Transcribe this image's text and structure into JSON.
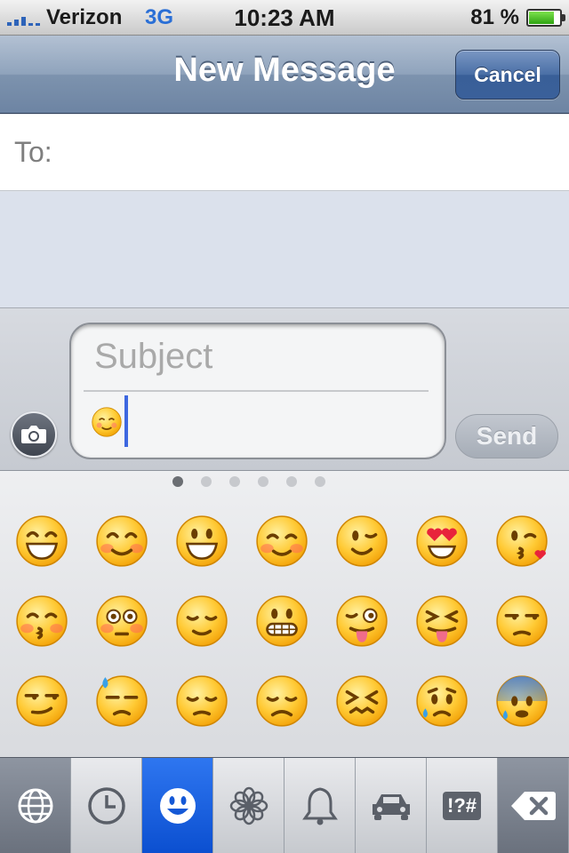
{
  "status_bar": {
    "carrier": "Verizon",
    "network": "3G",
    "time": "10:23 AM",
    "battery_percent": "81 %",
    "battery_level": 0.81
  },
  "nav_bar": {
    "title": "New Message",
    "cancel_label": "Cancel"
  },
  "recipient": {
    "label": "To:",
    "value": ""
  },
  "compose": {
    "subject_placeholder": "Subject",
    "body_value": "☺️",
    "send_label": "Send",
    "camera_icon": "camera-icon"
  },
  "keyboard": {
    "page_count": 6,
    "active_page": 1,
    "emoji_rows": [
      [
        "grinning-face",
        "smiling-face-blushing",
        "smiling-face-open-mouth",
        "relaxed-face",
        "winking-face",
        "heart-eyes-face",
        "face-throwing-kiss"
      ],
      [
        "kissing-closed-eyes-face",
        "flushed-face",
        "relieved-face",
        "grimacing-face",
        "winking-tongue-face",
        "squinting-tongue-face",
        "unamused-face"
      ],
      [
        "smirking-face",
        "downcast-sweat-face",
        "pensive-face",
        "disappointed-face",
        "confounded-face",
        "sad-tear-face",
        "fearful-sweat-face"
      ]
    ],
    "tabs": [
      {
        "name": "globe-icon",
        "state": "dark"
      },
      {
        "name": "recent-clock-icon",
        "state": "normal"
      },
      {
        "name": "smiley-icon",
        "state": "active"
      },
      {
        "name": "flower-icon",
        "state": "normal"
      },
      {
        "name": "bell-icon",
        "state": "normal"
      },
      {
        "name": "car-icon",
        "state": "normal"
      },
      {
        "name": "symbols-icon",
        "state": "normal",
        "label": "!?#"
      },
      {
        "name": "backspace-icon",
        "state": "dark"
      }
    ]
  }
}
